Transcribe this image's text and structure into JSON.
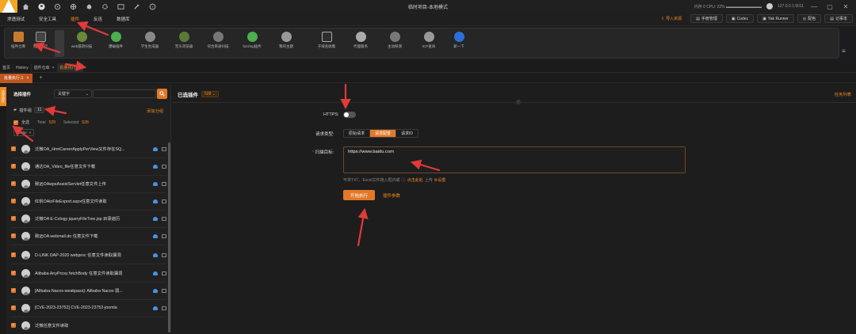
{
  "window": {
    "title": "临时项目-本地模式",
    "status": "内存 0 CPU: 22% ▬▬▬▬▬▬▬▬▬",
    "address": "127.0.0.1:9011",
    "btn_min": "—",
    "btn_max": "▢",
    "btn_close": "✕"
  },
  "menu": {
    "items": [
      "渗透测试",
      "安全工具",
      "插件",
      "反连",
      "数据库"
    ],
    "right_buttons": [
      "导入资源",
      "手册管理",
      "Codec",
      "Yak Runner",
      "配色",
      "记事本"
    ]
  },
  "plugin_toolbar": {
    "items": [
      {
        "label": "插件仓库"
      },
      {
        "label": "批量执行"
      },
      {
        "label": "web漏洞扫描"
      },
      {
        "label": "爆破插件"
      },
      {
        "label": "学生生成器"
      },
      {
        "label": "无头浏览器"
      },
      {
        "label": "综合目录扫描"
      },
      {
        "label": "fuzzlog插件"
      },
      {
        "label": "我的主题"
      },
      {
        "label": "子域名收集"
      },
      {
        "label": "代理服务"
      },
      {
        "label": "主动探测"
      },
      {
        "label": "ICP查询"
      },
      {
        "label": "新一下"
      }
    ]
  },
  "page_tabs": [
    {
      "label": "首页"
    },
    {
      "label": "History"
    },
    {
      "label": "插件仓库",
      "close": "×"
    },
    {
      "label": "批量执行",
      "close": "×"
    }
  ],
  "sub_tabs": {
    "active": "批量执行-1",
    "close": "×",
    "add": "+"
  },
  "left": {
    "side_label": "选择插件",
    "title": "选择插件",
    "search_mode": "关键字",
    "group": {
      "label": "插件组",
      "count": "11"
    },
    "add_group": "添加分组",
    "select_all": "全选",
    "total_label": "Total",
    "total": "528",
    "selected_label": "Selected",
    "selected": "528",
    "tag": "Nuclei",
    "tag_close": "×",
    "plugins": [
      {
        "title": "泛微OA_HrmCareerApplyPerView文件存在SQ..."
      },
      {
        "title": "通达OA_Video_file任意文件下载"
      },
      {
        "title": "致远OAwpsAssistServlet任意文件上传"
      },
      {
        "title": "红帆OAioFileExport.aspx任意文件读取"
      },
      {
        "title": "泛微OA E-Cology jqueryFileTree.jsp 目录遍历"
      },
      {
        "title": "致远OA webmail.do 任意文件下载"
      },
      {
        "title": "D-LINK DAP-2020 webproc 任意文件读取漏洞"
      },
      {
        "title": "Alibaba AnyProxy fetchBody 任意文件读取漏洞"
      },
      {
        "title": "[Alibaba-Nacos-weakpass]: Alibaba Nacos 弱..."
      },
      {
        "title": "[CVE-2023-23752] CVE-2023-23752-joomla"
      },
      {
        "title": "泛微任意文件读取"
      }
    ]
  },
  "right": {
    "title": "已选插件",
    "selected_count": "528",
    "clear": "任务列表",
    "https_label": "HTTPS:",
    "request_type_label": "请求类型:",
    "request_types": [
      "原始请求",
      "请求配置",
      "请求ID"
    ],
    "active_request_type": 1,
    "target_label": "扫描目标:",
    "target_value": "https://www.baidu.com",
    "hint": "可将TXT、Excel文件拖入框内或",
    "upload_link": "点击此处",
    "hint_upload": "上传",
    "settings_link": "设置",
    "start_button": "开始执行",
    "params_link": "插件参数"
  },
  "colors": {
    "accent": "#f08a24",
    "arrow": "#e03a3a",
    "bg": "#1c1c1e"
  }
}
